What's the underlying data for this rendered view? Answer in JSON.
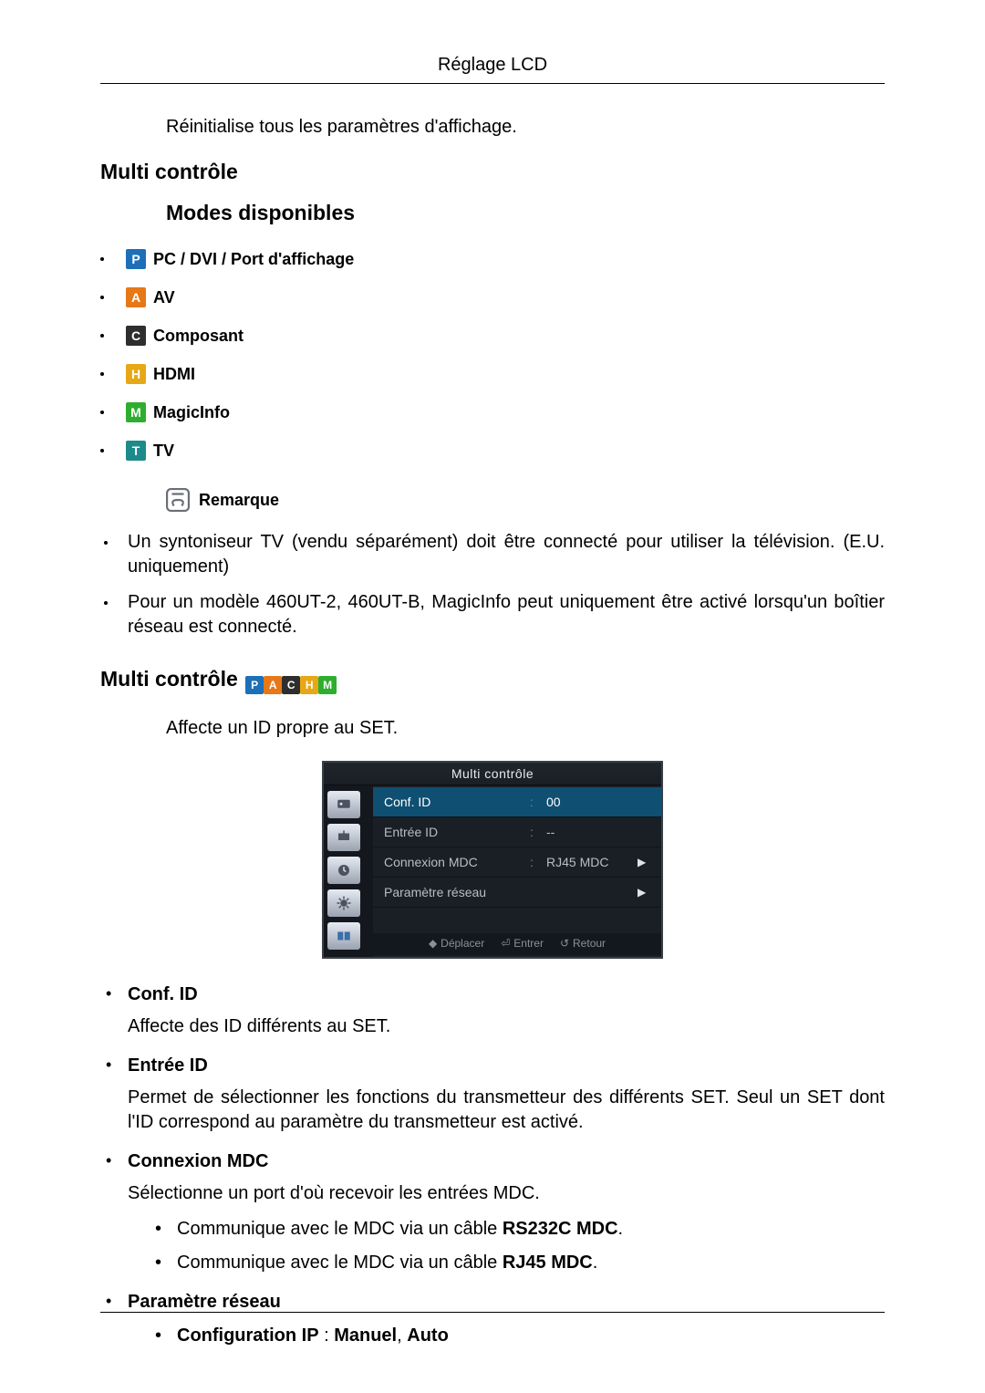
{
  "header": {
    "title": "Réglage LCD"
  },
  "intro": "Réinitialise tous les paramètres d'affichage.",
  "section1": {
    "title": "Multi contrôle",
    "subtitle": "Modes disponibles",
    "modes": [
      {
        "icon": "P",
        "label": "PC / DVI / Port d'affichage"
      },
      {
        "icon": "A",
        "label": "AV"
      },
      {
        "icon": "C",
        "label": "Composant"
      },
      {
        "icon": "H",
        "label": "HDMI"
      },
      {
        "icon": "M",
        "label": "MagicInfo"
      },
      {
        "icon": "T",
        "label": "TV"
      }
    ],
    "note_label": "Remarque",
    "notes": [
      "Un syntoniseur TV (vendu séparément) doit être connecté pour utiliser la télévision. (E.U. uniquement)",
      "Pour un modèle 460UT-2, 460UT-B, MagicInfo peut uniquement être activé lorsqu'un boîtier réseau est connecté."
    ],
    "note2_bold": "MagicInfo"
  },
  "section2": {
    "title": "Multi contrôle",
    "inline_icons": [
      "P",
      "A",
      "C",
      "H",
      "M"
    ],
    "intro": "Affecte un ID propre au SET."
  },
  "osd": {
    "title": "Multi contrôle",
    "rows": [
      {
        "label": "Conf. ID",
        "value": "00",
        "sel": true,
        "arrow": false
      },
      {
        "label": "Entrée ID",
        "value": "--",
        "sel": false,
        "arrow": false
      },
      {
        "label": "Connexion MDC",
        "value": "RJ45 MDC",
        "sel": false,
        "arrow": true
      },
      {
        "label": "Paramètre réseau",
        "value": "",
        "sel": false,
        "arrow": true
      }
    ],
    "footer": {
      "move": "Déplacer",
      "enter": "Entrer",
      "return": "Retour"
    }
  },
  "details": [
    {
      "title": "Conf. ID",
      "para": "Affecte des ID différents au SET."
    },
    {
      "title": "Entrée ID",
      "para": "Permet de sélectionner les fonctions du transmetteur des différents SET. Seul un SET dont l'ID correspond au paramètre du transmetteur est activé."
    },
    {
      "title": "Connexion MDC",
      "para": "Sélectionne un port d'où recevoir les entrées MDC.",
      "sub": [
        {
          "pre": "Communique avec le MDC via un câble ",
          "bold": "RS232C MDC",
          "post": "."
        },
        {
          "pre": "Communique avec le MDC via un câble ",
          "bold": "RJ45 MDC",
          "post": "."
        }
      ]
    },
    {
      "title": "Paramètre réseau",
      "sub2": {
        "label": "Configuration IP",
        "sep": " : ",
        "v1": "Manuel",
        "comma": ", ",
        "v2": "Auto"
      }
    }
  ]
}
